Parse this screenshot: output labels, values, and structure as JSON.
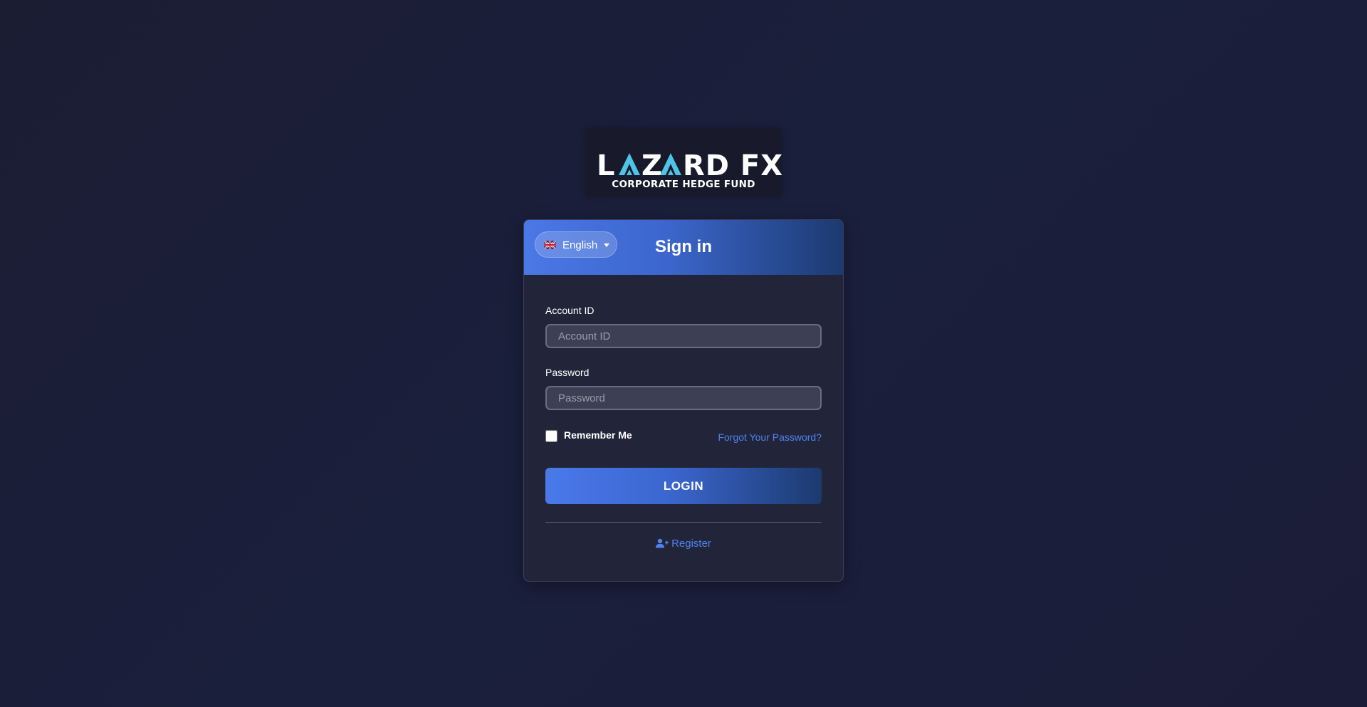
{
  "logo": {
    "main": "LAZARD FX",
    "tagline": "CORPORATE HEDGE FUND",
    "accent_color": "#4fc3e6"
  },
  "language": {
    "selected": "English",
    "flag_icon": "uk-flag-icon"
  },
  "card": {
    "title": "Sign in"
  },
  "form": {
    "account_label": "Account ID",
    "account_placeholder": "Account ID",
    "account_value": "",
    "password_label": "Password",
    "password_placeholder": "Password",
    "password_value": "",
    "remember_label": "Remember Me",
    "remember_checked": false,
    "forgot_link": "Forgot Your Password?",
    "login_button": "LOGIN",
    "register_link": "Register",
    "register_icon": "user-plus-icon"
  },
  "colors": {
    "background": "#1b1d35",
    "card": "#22253a",
    "primary": "#4a79ea",
    "link": "#4f83ee"
  }
}
